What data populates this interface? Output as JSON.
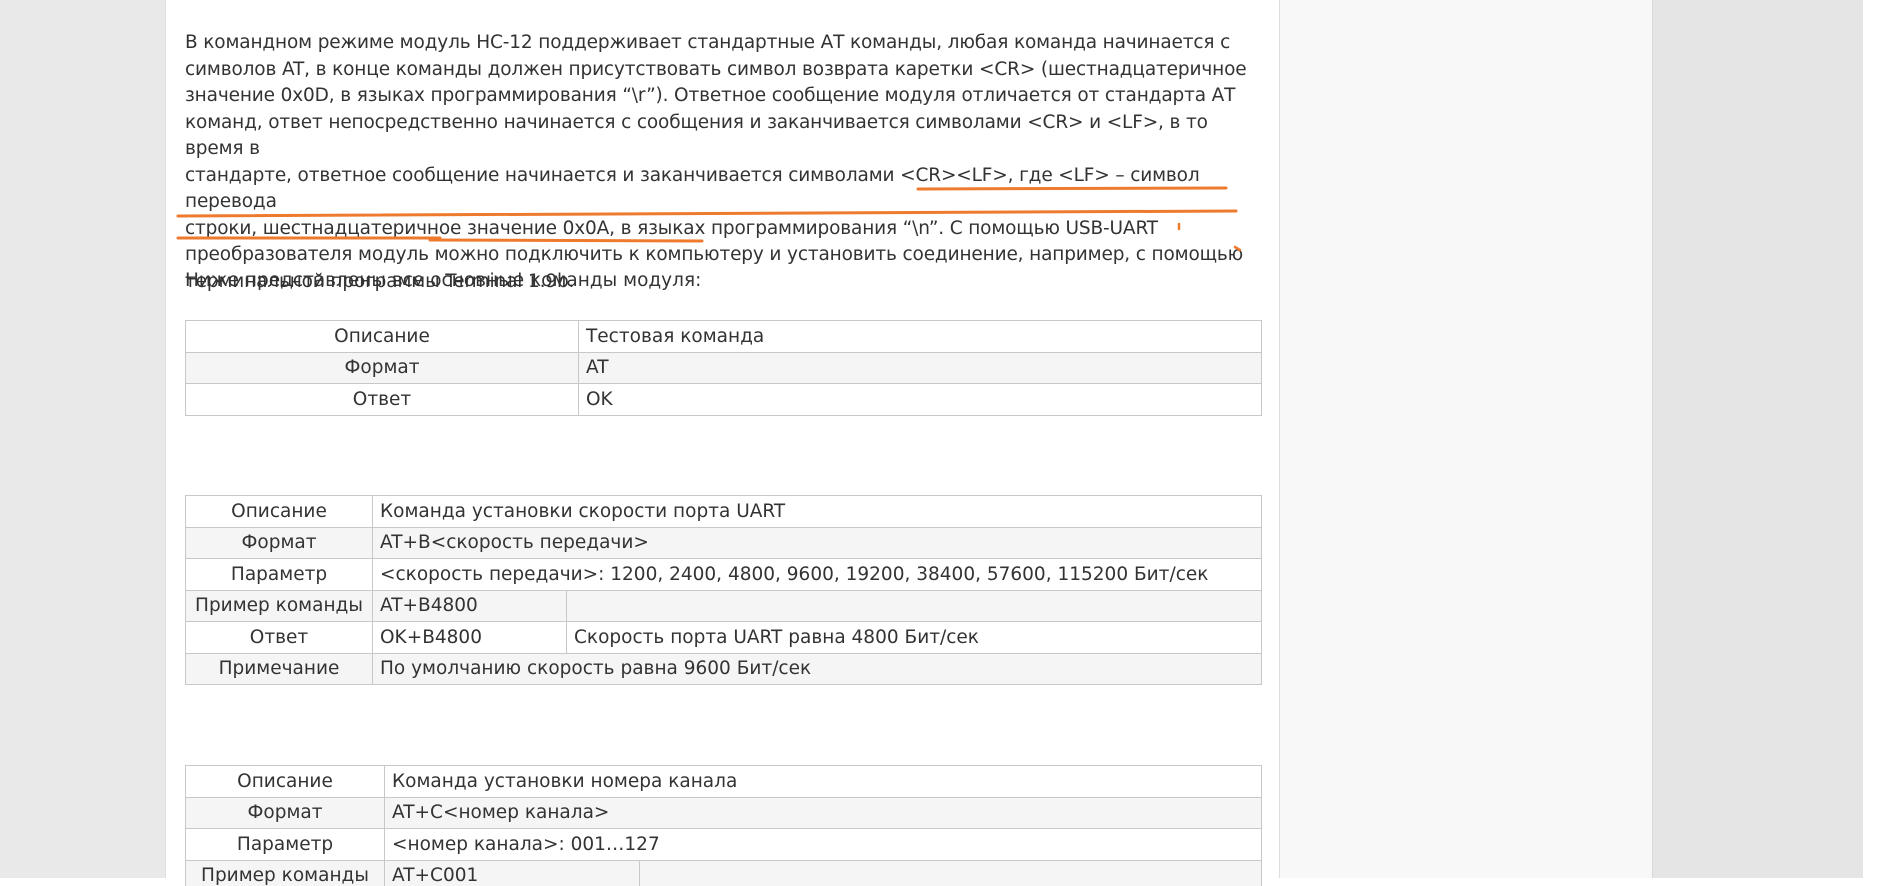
{
  "intro": {
    "lines": [
      "В командном режиме модуль HC-12 поддерживает стандартные АТ команды, любая команда начинается с",
      "символов AT, в конце команды должен присутствовать символ возврата каретки <CR> (шестнадцатеричное",
      "значение 0x0D, в языках программирования “\\r”). Ответное сообщение модуля отличается от стандарта АТ",
      "команд, ответ непосредственно начинается с сообщения и заканчивается символами <CR> и <LF>, в то время в",
      "стандарте, ответное сообщение начинается и заканчивается символами <CR><LF>, где <LF> – символ перевода",
      "строки, шестнадцатеричное значение 0x0A, в языках программирования “\\n”. С помощью USB-UART",
      "преобразователя модуль можно подключить к компьютеру и установить соединение, например, с помощью",
      "терминальной программы Terminal 1.9b."
    ],
    "lead": "Ниже представлены все основные команды модуля:"
  },
  "table1": {
    "rows": [
      {
        "label": "Описание",
        "value": "Тестовая команда"
      },
      {
        "label": "Формат",
        "value": "AT"
      },
      {
        "label": "Ответ",
        "value": "OK"
      }
    ]
  },
  "table2": {
    "rows": [
      {
        "label": "Описание",
        "value": "Команда установки скорости порта UART",
        "note": ""
      },
      {
        "label": "Формат",
        "value": "AT+B<скорость передачи>",
        "note": ""
      },
      {
        "label": "Параметр",
        "value": "<скорость передачи>: 1200, 2400, 4800, 9600, 19200, 38400, 57600, 115200 Бит/сек",
        "note": ""
      },
      {
        "label": "Пример команды",
        "value": "AT+B4800",
        "note": ""
      },
      {
        "label": "Ответ",
        "value": "OK+B4800",
        "note": "Скорость порта UART равна 4800 Бит/сек"
      },
      {
        "label": "Примечание",
        "value": "По умолчанию скорость равна 9600 Бит/сек",
        "note": ""
      }
    ]
  },
  "table3": {
    "rows": [
      {
        "label": "Описание",
        "value": "Команда установки номера канала",
        "note": ""
      },
      {
        "label": "Формат",
        "value": "AT+C<номер канала>",
        "note": ""
      },
      {
        "label": "Параметр",
        "value": "<номер канала>: 001…127",
        "note": ""
      },
      {
        "label": "Пример команды",
        "value": "AT+C001",
        "note": ""
      }
    ]
  },
  "colors": {
    "annotation": "#ee7a2e",
    "text": "#333333",
    "border": "#c8c8c8"
  }
}
